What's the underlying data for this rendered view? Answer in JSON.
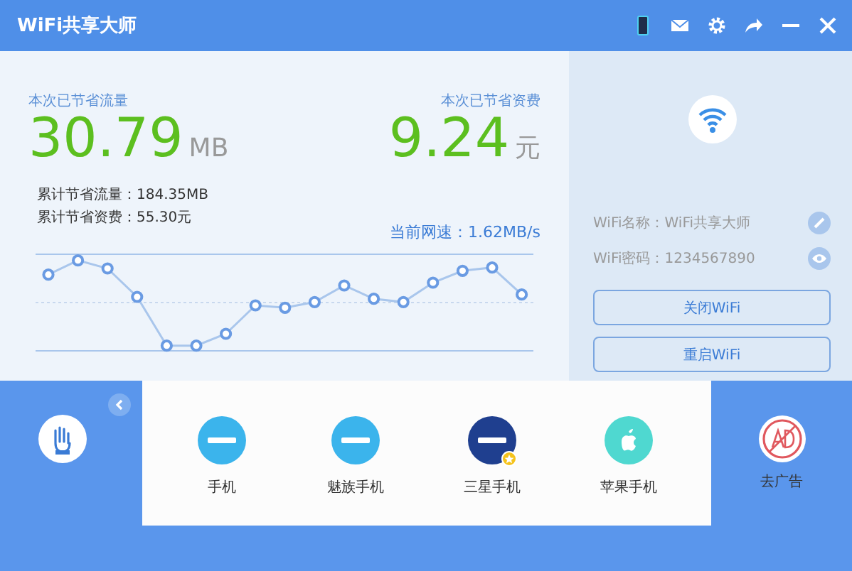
{
  "window": {
    "title": "WiFi共享大师"
  },
  "savings": [
    {
      "label": "本次已节省流量",
      "value": "30.79",
      "unit": "MB"
    },
    {
      "label": "本次已节省资费",
      "value": "9.24",
      "unit": "元"
    }
  ],
  "totals": [
    "累计节省流量：184.35MB",
    "累计节省资费：55.30元"
  ],
  "speed": "当前网速：1.62MB/s",
  "wifi": {
    "name": "WiFi名称：WiFi共享大师",
    "password": "WiFi密码：1234567890"
  },
  "buttons": [
    "关闭WiFi",
    "重启WiFi"
  ],
  "devices": [
    {
      "label": "手机",
      "kind": "meizu",
      "starred": false
    },
    {
      "label": "魅族手机",
      "kind": "meizu",
      "starred": false
    },
    {
      "label": "三星手机",
      "kind": "samsung",
      "starred": true
    },
    {
      "label": "苹果手机",
      "kind": "apple",
      "starred": false
    }
  ],
  "ad": {
    "label": "去广告"
  }
}
